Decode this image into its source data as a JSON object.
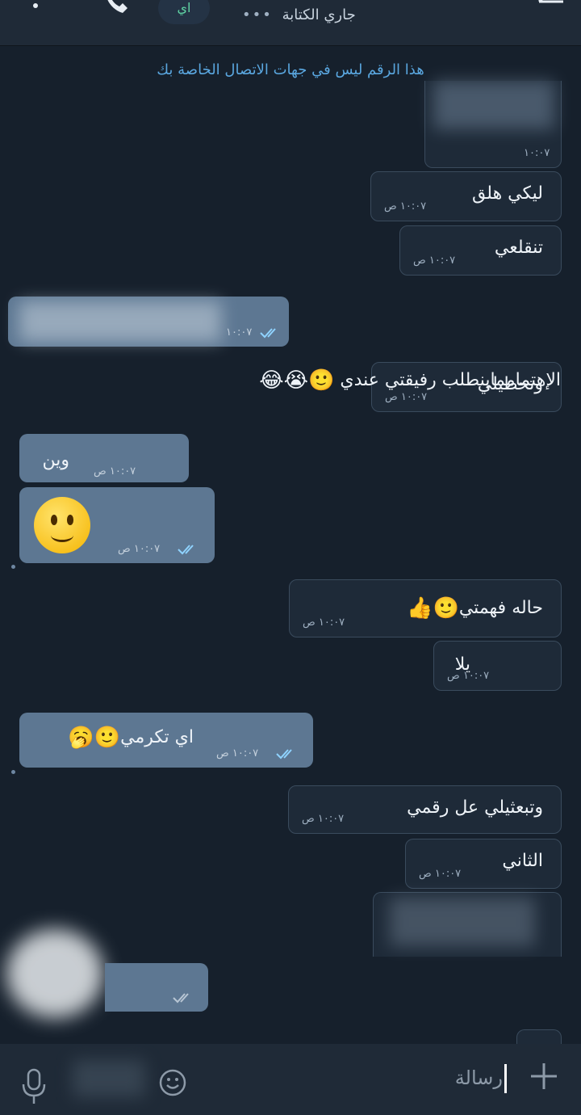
{
  "header": {
    "status": "جاري الكتابة",
    "avatar_letter": "اي",
    "more_icon": "more-vertical-icon",
    "call_icon": "phone-icon",
    "back_icon": "back-arrow-icon"
  },
  "banner": "هذا الرقم ليس في جهات الاتصال الخاصة بك",
  "messages": [
    {
      "text": "",
      "time": "١٠:٠٧"
    },
    {
      "text": "ليكي هلق",
      "time": "١٠:٠٧ ص"
    },
    {
      "text": "تنقلعي",
      "time": "١٠:٠٧ ص"
    },
    {
      "text": "",
      "time": "١٠:٠٧"
    },
    {
      "text": "وتحطيلي",
      "time": "١٠:٠٧ ص"
    },
    {
      "text": "وين",
      "time": "١٠:٠٧ ص"
    },
    {
      "text": "",
      "time": "١٠:٠٧ ص"
    },
    {
      "text": "حاله فهمتي",
      "time": "١٠:٠٧ ص"
    },
    {
      "text": "يلا",
      "time": "١٠:٠٧ ص"
    },
    {
      "text": "اي تكرمي",
      "time": "١٠:٠٧ ص"
    },
    {
      "text": "وتبعثيلي عل رقمي",
      "time": "١٠:٠٧ ص"
    },
    {
      "text": "الثاني",
      "time": "١٠:٠٧ ص"
    }
  ],
  "floating_text": "الإهتمامماينطلب رفيقتي عندي",
  "composer": {
    "placeholder": "رسالة",
    "attach_icon": "plus-icon",
    "emoji_icon": "emoji-icon",
    "mic_icon": "mic-icon"
  },
  "colors": {
    "background": "#16202c",
    "header": "#1f2a37",
    "outgoing_bubble": "#5d7792",
    "incoming_border": "#3a4b5d",
    "link_blue": "#5aa7e0"
  }
}
